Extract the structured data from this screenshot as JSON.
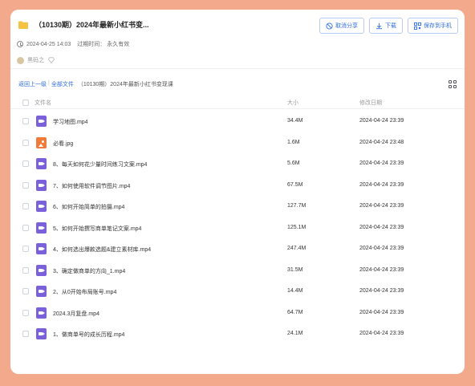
{
  "header": {
    "title": "（10130期）2024年最新小红书变...",
    "created_at": "2024-04-25 14:03",
    "expire_label": "过期时间：",
    "expire_value": "永久有效",
    "sharer_name": "黑码之"
  },
  "actions": {
    "cancel_share": "取消分享",
    "download": "下载",
    "save_to_phone": "保存到手机"
  },
  "breadcrumb": {
    "back": "返回上一级",
    "all_files": "全部文件",
    "current": "（10130期）2024年最新小红书变现课"
  },
  "table": {
    "col_name": "文件名",
    "col_size": "大小",
    "col_date": "修改日期",
    "rows": [
      {
        "name": "学习地图.mp4",
        "size": "34.4M",
        "date": "2024-04-24 23:39",
        "type": "video"
      },
      {
        "name": "必看.jpg",
        "size": "1.6M",
        "date": "2024-04-24 23:48",
        "type": "image"
      },
      {
        "name": "8、每天如何花少量时间练习文案.mp4",
        "size": "5.6M",
        "date": "2024-04-24 23:39",
        "type": "video"
      },
      {
        "name": "7、如何使用软件调节图片.mp4",
        "size": "67.5M",
        "date": "2024-04-24 23:39",
        "type": "video"
      },
      {
        "name": "6、如何开始简单的拍摄.mp4",
        "size": "127.7M",
        "date": "2024-04-24 23:39",
        "type": "video"
      },
      {
        "name": "5、如何开始撰写商单笔记文案.mp4",
        "size": "125.1M",
        "date": "2024-04-24 23:39",
        "type": "video"
      },
      {
        "name": "4、如何选出爆款选题&建立素材库.mp4",
        "size": "247.4M",
        "date": "2024-04-24 23:39",
        "type": "video"
      },
      {
        "name": "3、确定做商单的方向_1.mp4",
        "size": "31.5M",
        "date": "2024-04-24 23:39",
        "type": "video"
      },
      {
        "name": "2、从0开始布局账号.mp4",
        "size": "14.4M",
        "date": "2024-04-24 23:39",
        "type": "video"
      },
      {
        "name": "2024.3月复盘.mp4",
        "size": "64.7M",
        "date": "2024-04-24 23:39",
        "type": "video"
      },
      {
        "name": "1、做商单号的成长历程.mp4",
        "size": "24.1M",
        "date": "2024-04-24 23:39",
        "type": "video"
      }
    ]
  },
  "colors": {
    "page_background": "#f3a98c",
    "accent": "#2f6ee0",
    "video_icon": "#7b61d9",
    "image_icon": "#f07a3a"
  }
}
